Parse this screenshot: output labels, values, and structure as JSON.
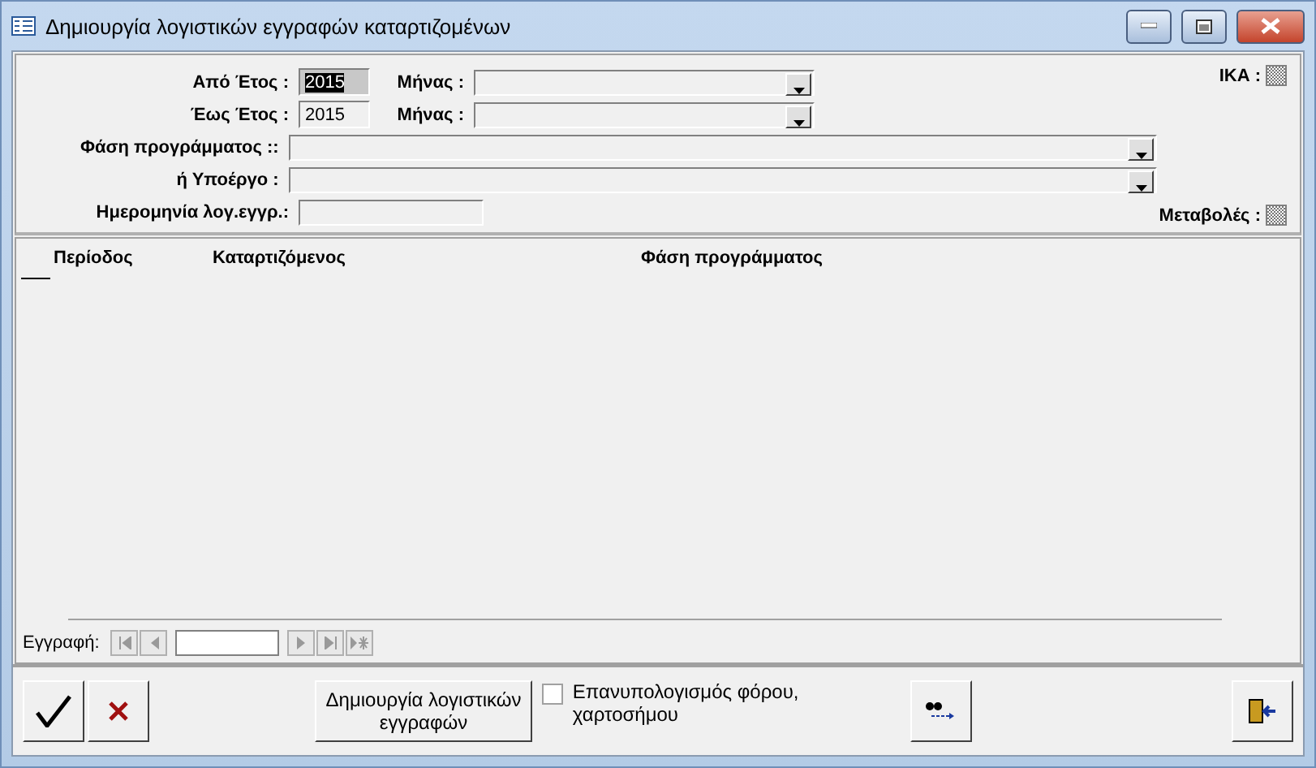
{
  "window": {
    "title": "Δημιουργία λογιστικών εγγραφών καταρτιζομένων"
  },
  "filters": {
    "from_year": {
      "label": "Από  Έτος :",
      "value": "2015",
      "selected": true
    },
    "from_month": {
      "label": "Μήνας :"
    },
    "to_year": {
      "label": "Έως  Έτος :",
      "value": "2015",
      "selected": false
    },
    "to_month": {
      "label": "Μήνας :"
    },
    "phase": {
      "label": "Φάση προγράμματος ::"
    },
    "subproject": {
      "label": "ή Υποέργο :"
    },
    "date": {
      "label": "Ημερομηνία λογ.εγγρ.:"
    },
    "ika": {
      "label": "ΙΚΑ :",
      "indeterminate": true
    },
    "changes": {
      "label": "Μεταβολές :",
      "indeterminate": true
    }
  },
  "table": {
    "columns": [
      "Περίοδος",
      "Καταρτιζόμενος",
      "Φάση προγράμματος"
    ]
  },
  "navigator": {
    "label": "Εγγραφή:"
  },
  "toolbar": {
    "create_button": "Δημιουργία λογιστικών εγγραφών",
    "recalc": {
      "label": "Επανυπολογισμός φόρου, χαρτοσήμου",
      "checked": false
    }
  }
}
